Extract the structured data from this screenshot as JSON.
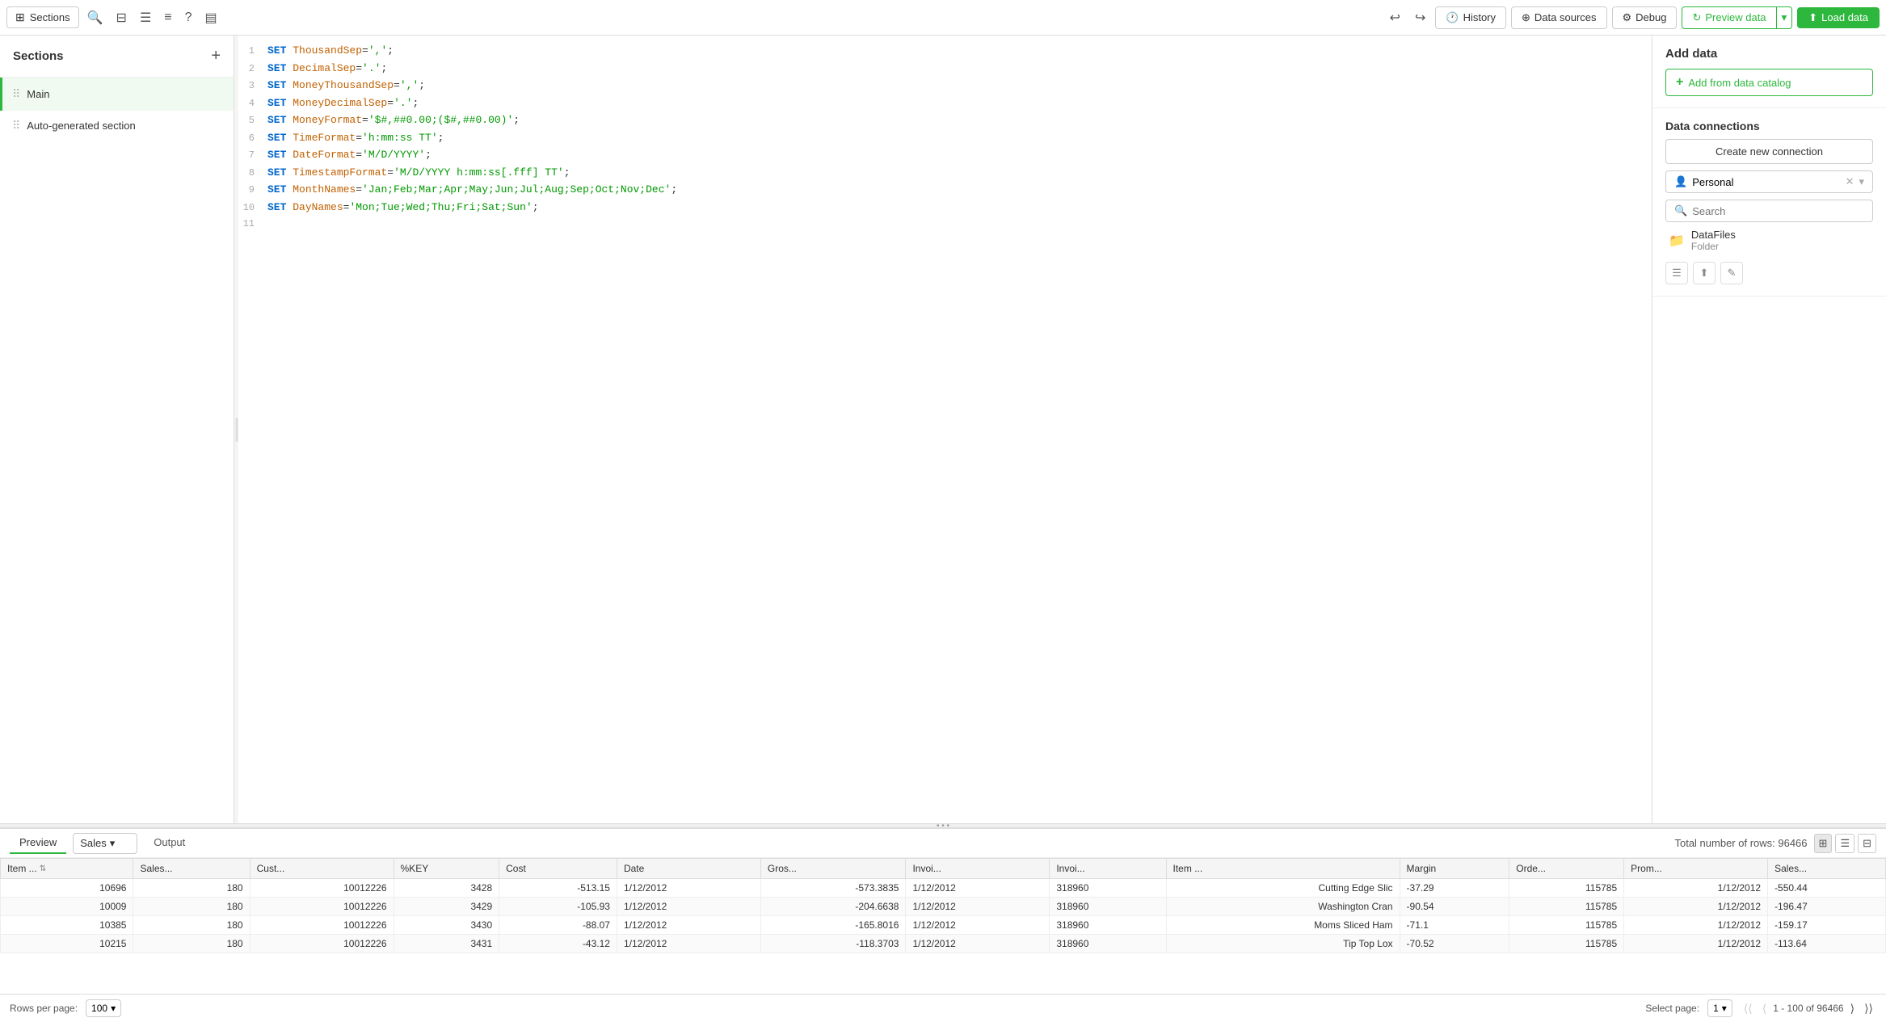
{
  "toolbar": {
    "sections_label": "Sections",
    "history_label": "History",
    "data_sources_label": "Data sources",
    "debug_label": "Debug",
    "preview_data_label": "Preview data",
    "load_data_label": "Load data"
  },
  "sidebar": {
    "title": "Sections",
    "items": [
      {
        "label": "Main",
        "active": true
      },
      {
        "label": "Auto-generated section",
        "active": false
      }
    ]
  },
  "editor": {
    "lines": [
      {
        "num": 1,
        "content": "SET ThousandSep=',';"
      },
      {
        "num": 2,
        "content": "SET DecimalSep='.';"
      },
      {
        "num": 3,
        "content": "SET MoneyThousandSep=',';"
      },
      {
        "num": 4,
        "content": "SET MoneyDecimalSep='.';"
      },
      {
        "num": 5,
        "content": "SET MoneyFormat='$#,##0.00;($#,##0.00)';"
      },
      {
        "num": 6,
        "content": "SET TimeFormat='h:mm:ss TT';"
      },
      {
        "num": 7,
        "content": "SET DateFormat='M/D/YYYY';"
      },
      {
        "num": 8,
        "content": "SET TimestampFormat='M/D/YYYY h:mm:ss[.fff] TT';"
      },
      {
        "num": 9,
        "content": "SET MonthNames='Jan;Feb;Mar;Apr;May;Jun;Jul;Aug;Sep;Oct;Nov;Dec';"
      },
      {
        "num": 10,
        "content": "SET DayNames='Mon;Tue;Wed;Thu;Fri;Sat;Sun';"
      },
      {
        "num": 11,
        "content": ""
      }
    ]
  },
  "right_panel": {
    "add_data_title": "Add data",
    "add_catalog_label": "Add from data catalog",
    "data_connections_title": "Data connections",
    "create_connection_label": "Create new connection",
    "connection_name": "Personal",
    "search_placeholder": "Search",
    "folder_name": "DataFiles",
    "folder_label": "Folder"
  },
  "bottom": {
    "preview_tab": "Preview",
    "output_tab": "Output",
    "table_selector": "Sales",
    "total_rows_label": "Total number of rows: 96466",
    "columns": [
      "Item ...",
      "Sales...",
      "Cust...",
      "%KEY",
      "Cost",
      "Date",
      "Gros...",
      "Invoi...",
      "Invoi...",
      "Item ...",
      "Margin",
      "Orde...",
      "Prom...",
      "Sales..."
    ],
    "rows": [
      [
        "10696",
        "180",
        "10012226",
        "3428",
        "-513.15",
        "1/12/2012",
        "-573.3835",
        "1/12/2012",
        "318960",
        "Cutting Edge Slic",
        "-37.29",
        "115785",
        "1/12/2012",
        "-550.44"
      ],
      [
        "10009",
        "180",
        "10012226",
        "3429",
        "-105.93",
        "1/12/2012",
        "-204.6638",
        "1/12/2012",
        "318960",
        "Washington Cran",
        "-90.54",
        "115785",
        "1/12/2012",
        "-196.47"
      ],
      [
        "10385",
        "180",
        "10012226",
        "3430",
        "-88.07",
        "1/12/2012",
        "-165.8016",
        "1/12/2012",
        "318960",
        "Moms Sliced Ham",
        "-71.1",
        "115785",
        "1/12/2012",
        "-159.17"
      ],
      [
        "10215",
        "180",
        "10012226",
        "3431",
        "-43.12",
        "1/12/2012",
        "-118.3703",
        "1/12/2012",
        "318960",
        "Tip Top Lox",
        "-70.52",
        "115785",
        "1/12/2012",
        "-113.64"
      ]
    ],
    "rows_per_page_label": "Rows per page:",
    "rows_per_page_value": "100",
    "select_page_label": "Select page:",
    "select_page_value": "1",
    "pagination_info": "1 - 100 of 96466"
  }
}
